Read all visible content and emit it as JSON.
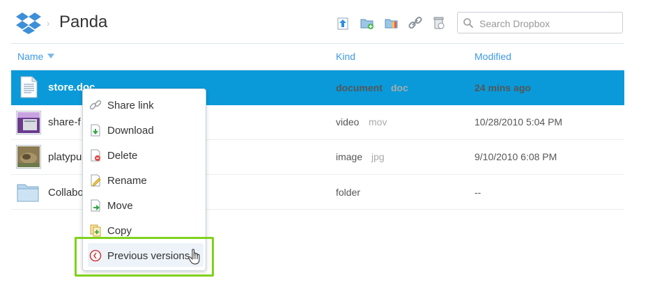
{
  "header": {
    "logo": "dropbox-logo",
    "breadcrumb_sep": "›",
    "title": "Panda",
    "toolbar_icons": [
      "upload-icon",
      "new-folder-icon",
      "share-folder-icon",
      "get-link-icon",
      "deleted-files-icon"
    ],
    "search_placeholder": "Search Dropbox"
  },
  "columns": {
    "name": "Name",
    "kind": "Kind",
    "modified": "Modified"
  },
  "rows": [
    {
      "name": "store.doc",
      "kind": "document",
      "ext": "doc",
      "modified": "24 mins ago",
      "icon": "doc-file-icon",
      "selected": true
    },
    {
      "name": "share-f",
      "kind": "video",
      "ext": "mov",
      "modified": "10/28/2010 5:04 PM",
      "icon": "video-thumbnail"
    },
    {
      "name": "platypu",
      "kind": "image",
      "ext": "jpg",
      "modified": "9/10/2010 6:08 PM",
      "icon": "image-thumbnail"
    },
    {
      "name": "Collabo",
      "kind": "folder",
      "ext": "",
      "modified": "--",
      "icon": "folder-icon"
    }
  ],
  "context_menu": {
    "items": [
      {
        "label": "Share link",
        "icon": "link-icon"
      },
      {
        "label": "Download",
        "icon": "download-icon"
      },
      {
        "label": "Delete",
        "icon": "delete-icon"
      },
      {
        "label": "Rename",
        "icon": "rename-icon"
      },
      {
        "label": "Move",
        "icon": "move-icon"
      },
      {
        "label": "Copy",
        "icon": "copy-icon"
      },
      {
        "label": "Previous versions",
        "icon": "clock-icon",
        "highlighted": true
      }
    ]
  },
  "colors": {
    "accent": "#3d9ae4",
    "selection": "#0a9ad9",
    "highlight_outline": "#7fd11b"
  }
}
